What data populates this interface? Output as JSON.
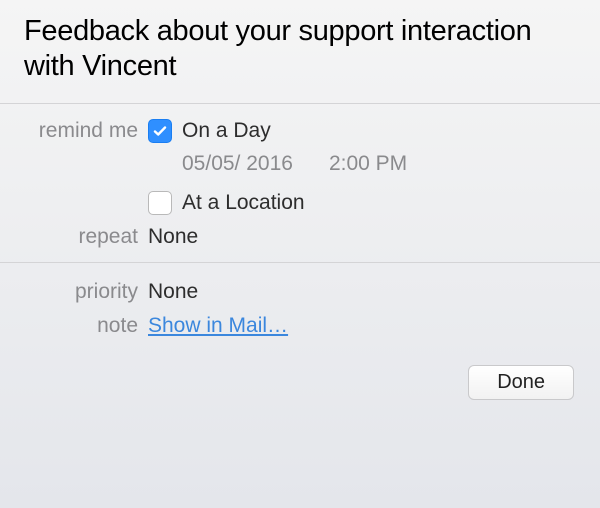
{
  "title": "Feedback about your support interaction with Vincent",
  "labels": {
    "remind_me": "remind me",
    "repeat": "repeat",
    "priority": "priority",
    "note": "note"
  },
  "remind": {
    "on_day_label": "On a Day",
    "on_day_checked": true,
    "date": "05/05/ 2016",
    "time": "2:00 PM",
    "at_location_label": "At a Location",
    "at_location_checked": false
  },
  "repeat_value": "None",
  "priority_value": "None",
  "note_link": "Show in Mail…",
  "done_label": "Done"
}
